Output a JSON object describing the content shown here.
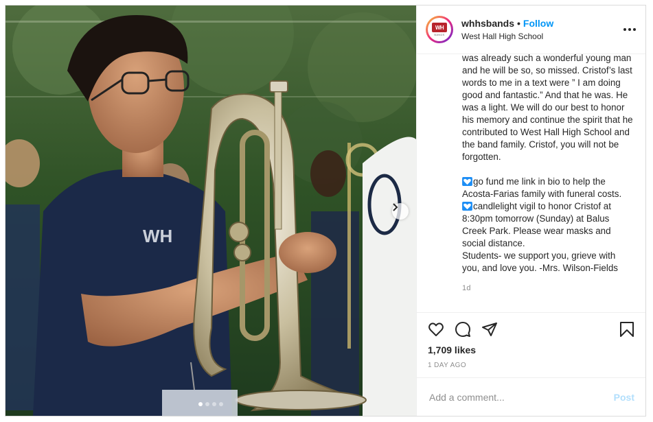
{
  "post": {
    "username": "whhsbands",
    "separator": "•",
    "follow_label": "Follow",
    "location": "West Hall High School",
    "avatar_text": "WH",
    "avatar_subtext": "BANDS",
    "more_icon": "ellipsis-icon"
  },
  "caption": {
    "lines_1": "was already such a wonderful young man and he will be so, so missed. Cristof’s last words to me in a text were ” I am doing good and fantastic.” And that he was. He was a light. We will do our best to honor his memory and continue the spirit that he contributed to West Hall High School and the band family. Cristof, you will not be forgotten.",
    "line_gofund": "go fund me link in bio to help the Acosta-Farias family with funeral costs.",
    "line_vigil": "candlelight vigil to honor Cristof at 8:30pm tomorrow (Sunday) at Balus Creek Park. Please wear masks and social distance.",
    "line_students": "Students- we support you, grieve with you, and love you. -Mrs. Wilson-Fields",
    "emoji": "blue-heart-icon",
    "time": "1d"
  },
  "actions": {
    "like_icon": "heart-icon",
    "comment_icon": "comment-icon",
    "share_icon": "share-icon",
    "save_icon": "bookmark-icon",
    "likes": "1,709 likes",
    "posted_ago": "1 DAY AGO"
  },
  "comment": {
    "placeholder": "Add a comment...",
    "post_label": "Post"
  },
  "carousel": {
    "slide_count": 4,
    "active_index": 0
  },
  "colors": {
    "follow": "#0095f6",
    "post_disabled": "#b2dffc",
    "heart_emoji": "#1d8ef5"
  }
}
